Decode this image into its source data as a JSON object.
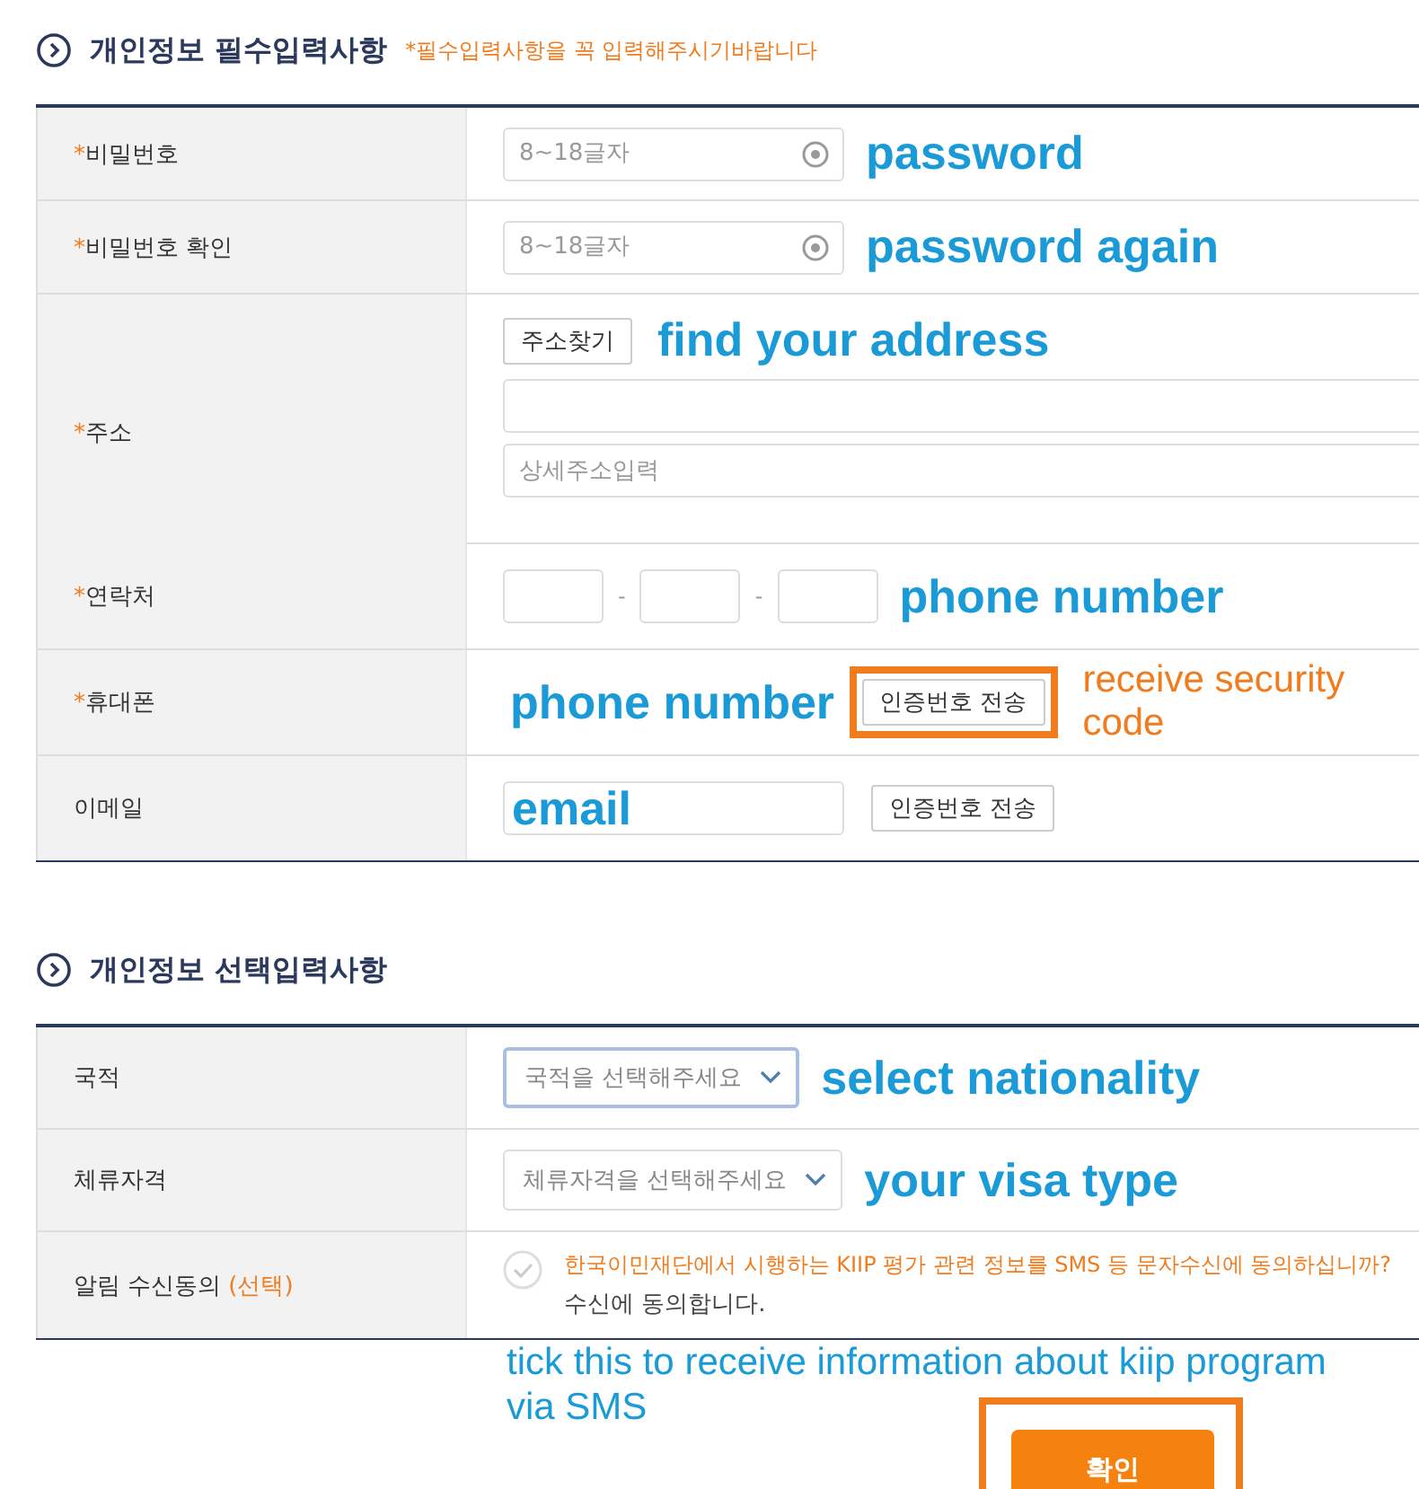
{
  "sections": [
    {
      "title": "개인정보 필수입력사항",
      "note": "*필수입력사항을 꼭 입력해주시기바랍니다",
      "rows": [
        {
          "kind": "password",
          "mark": "*",
          "label": "비밀번호",
          "placeholder": "8~18글자",
          "annotation": {
            "text": "password",
            "color": "#1a9ad6"
          }
        },
        {
          "kind": "password",
          "mark": "*",
          "label": "비밀번호 확인",
          "placeholder": "8~18글자",
          "annotation": {
            "text": "password again",
            "color": "#1a9ad6"
          }
        },
        {
          "kind": "address",
          "mark": "*",
          "label": "주소",
          "button": "주소찾기",
          "placeholder": "상세주소입력",
          "annotation": {
            "text": "find your address",
            "color": "#1a9ad6"
          }
        },
        {
          "kind": "phone",
          "mark": "*",
          "label": "연락처",
          "separator": "-",
          "annotation": {
            "text": "phone number",
            "color": "#1a9ad6"
          }
        },
        {
          "kind": "mobile",
          "mark": "*",
          "label": "휴대폰",
          "button": "인증번호 전송",
          "button_highlighted": true,
          "overlay": {
            "text": "phone number",
            "color": "#1a9ad6"
          },
          "annotation": {
            "text": "receive security code",
            "color": "#f07c1e"
          }
        },
        {
          "kind": "email",
          "label": "이메일",
          "value": "email",
          "button": "인증번호 전송",
          "button_highlighted": false
        }
      ]
    },
    {
      "title": "개인정보 선택입력사항",
      "rows": [
        {
          "kind": "select",
          "label": "국적",
          "placeholder": "국적을 선택해주세요",
          "focused": true,
          "annotation": {
            "text": "select nationality",
            "color": "#1a9ad6"
          }
        },
        {
          "kind": "select",
          "label": "체류자격",
          "placeholder": "체류자격을 선택해주세요",
          "focused": false,
          "annotation": {
            "text": "your visa type",
            "color": "#1a9ad6"
          }
        },
        {
          "kind": "consent",
          "label": "알림 수신동의",
          "tag": "(선택)",
          "question": "한국이민재단에서 시행하는 KIIP 평가 관련 정보를 SMS 등 문자수신에 동의하십니까?",
          "agree": "수신에 동의합니다.",
          "checked": false
        }
      ]
    }
  ],
  "footer": {
    "annotation": {
      "text": "tick this to receive information about kiip program via SMS",
      "color": "#1a9ad6"
    },
    "confirm_button": "확인",
    "button_highlighted": true
  }
}
